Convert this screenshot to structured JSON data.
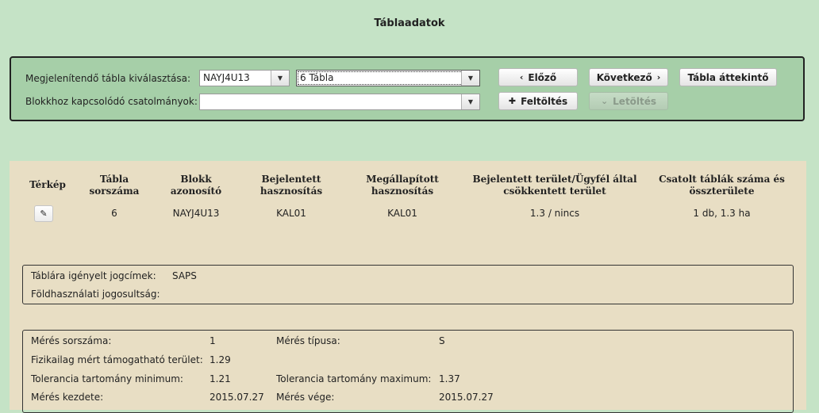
{
  "page": {
    "title": "Táblaadatok"
  },
  "selector": {
    "table_label": "Megjelenítendő tábla kiválasztása:",
    "block_value": "NAYJ4U13",
    "table_value": "6  Tábla",
    "attachments_label": "Blokkhoz kapcsolódó csatolmányok:",
    "attachments_value": "",
    "prev_label": "Előző",
    "next_label": "Következő",
    "overview_label": "Tábla áttekintő",
    "upload_label": "Feltöltés",
    "download_label": "Letöltés"
  },
  "table": {
    "headers": [
      "Térkép",
      "Tábla sorszáma",
      "Blokk azonosító",
      "Bejelentett hasznosítás",
      "Megállapított hasznosítás",
      "Bejelentett terület/Ügyfél által csökkentett terület",
      "Csatolt táblák száma és összterülete"
    ],
    "row": {
      "sorszam": "6",
      "blokk": "NAYJ4U13",
      "bejelentett": "KAL01",
      "megallapitott": "KAL01",
      "terulet": "1.3 / nincs",
      "csatolt": "1 db, 1.3 ha"
    }
  },
  "jogcim": {
    "igenyelt_label": "Táblára igényelt jogcímek:",
    "igenyelt_value": "SAPS",
    "fold_label": "Földhasználati jogosultság:",
    "fold_value": ""
  },
  "meres": {
    "sorszam_label": "Mérés sorszáma:",
    "sorszam_value": "1",
    "tipus_label": "Mérés típusa:",
    "tipus_value": "S",
    "fizikai_label": "Fizikailag mért támogatható terület:",
    "fizikai_value": "1.29",
    "tol_min_label": "Tolerancia tartomány minimum:",
    "tol_min_value": "1.21",
    "tol_max_label": "Tolerancia tartomány maximum:",
    "tol_max_value": "1.37",
    "kezdete_label": "Mérés kezdete:",
    "kezdete_value": "2015.07.27",
    "vege_label": "Mérés vége:",
    "vege_value": "2015.07.27"
  },
  "colors": {
    "background": "#c5e3c6",
    "panel": "#a6cfa8",
    "content": "#e8dec4"
  },
  "icons": {
    "prev": "chevron-left-icon",
    "next": "chevron-right-icon",
    "upload": "plus-icon",
    "download": "chevron-down-icon",
    "map": "pencil-icon",
    "dropdown": "caret-down-icon"
  }
}
